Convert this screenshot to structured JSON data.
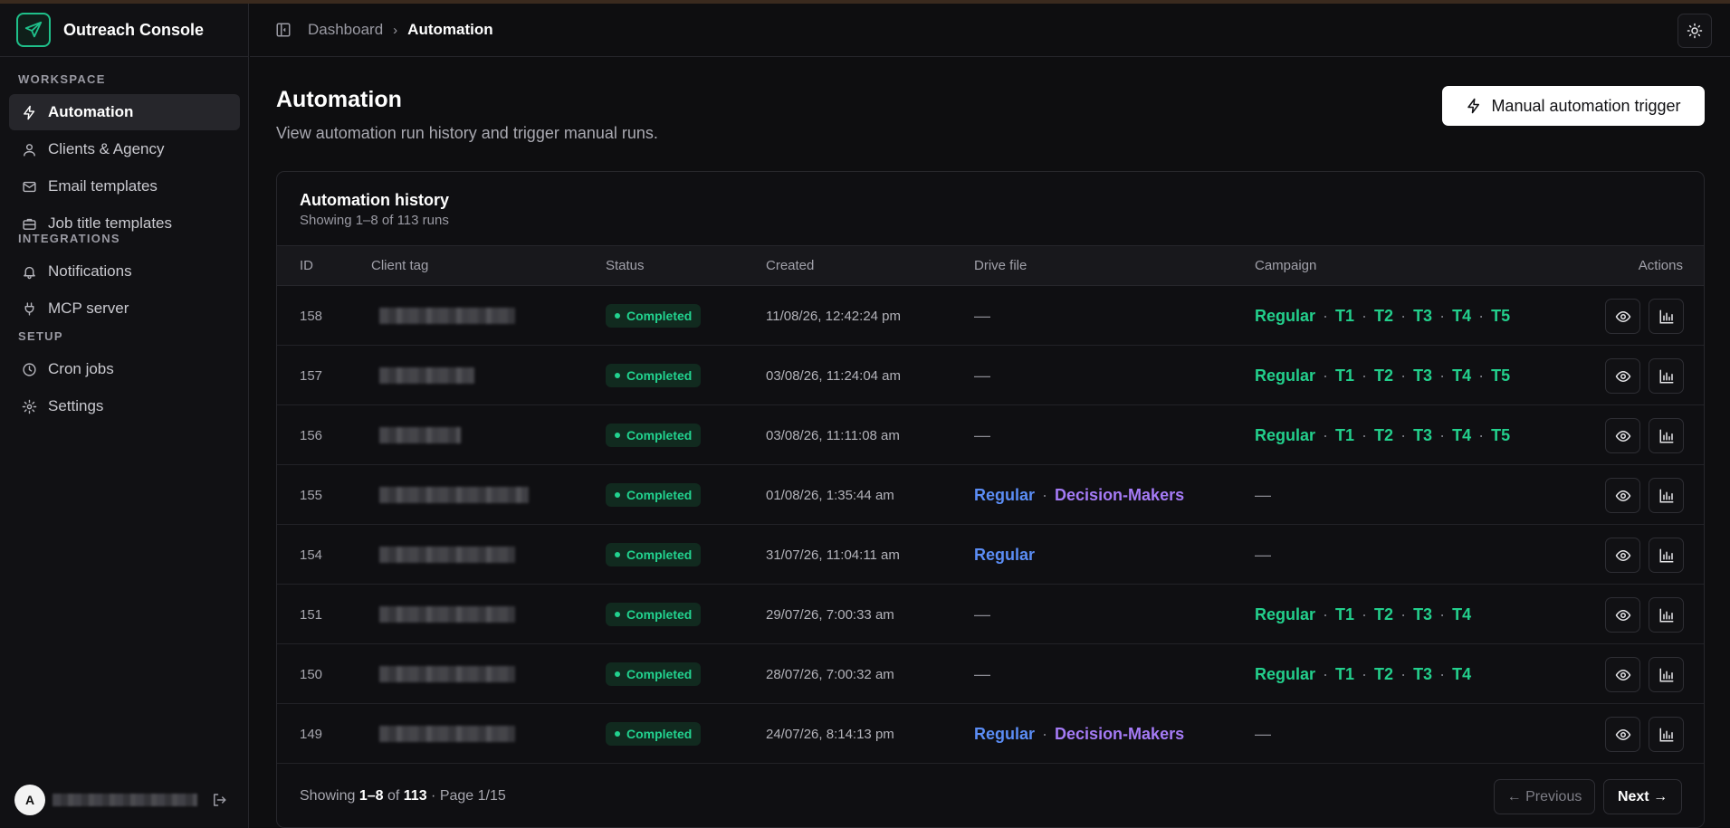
{
  "app": {
    "name": "Outreach Console",
    "user_initial": "A"
  },
  "sidebar": {
    "sections": [
      {
        "label": "Workspace",
        "items": [
          {
            "label": "Automation",
            "icon": "zap-icon",
            "active": true
          },
          {
            "label": "Clients & Agency",
            "icon": "user-icon"
          },
          {
            "label": "Email templates",
            "icon": "mail-icon"
          },
          {
            "label": "Job title templates",
            "icon": "briefcase-icon"
          }
        ]
      },
      {
        "label": "Integrations",
        "items": [
          {
            "label": "Notifications",
            "icon": "bell-icon"
          },
          {
            "label": "MCP server",
            "icon": "plug-icon"
          }
        ]
      },
      {
        "label": "Setup",
        "items": [
          {
            "label": "Cron jobs",
            "icon": "clock-icon"
          },
          {
            "label": "Settings",
            "icon": "gear-icon"
          }
        ]
      }
    ]
  },
  "header": {
    "breadcrumb": [
      "Dashboard",
      "Automation"
    ]
  },
  "page": {
    "title": "Automation",
    "subtitle": "View automation run history and trigger manual runs.",
    "trigger_label": "Manual automation trigger"
  },
  "history": {
    "title": "Automation history",
    "subtitle": "Showing 1–8 of 113 runs",
    "columns": [
      "ID",
      "Client tag",
      "Status",
      "Created",
      "Drive file",
      "Campaign",
      "Actions"
    ],
    "rows": [
      {
        "id": "158",
        "status": "Completed",
        "created": "11/08/26, 12:42:24 pm",
        "drive": [],
        "campaign": [
          "Regular",
          "T1",
          "T2",
          "T3",
          "T4",
          "T5"
        ]
      },
      {
        "id": "157",
        "status": "Completed",
        "created": "03/08/26, 11:24:04 am",
        "drive": [],
        "campaign": [
          "Regular",
          "T1",
          "T2",
          "T3",
          "T4",
          "T5"
        ]
      },
      {
        "id": "156",
        "status": "Completed",
        "created": "03/08/26, 11:11:08 am",
        "drive": [],
        "campaign": [
          "Regular",
          "T1",
          "T2",
          "T3",
          "T4",
          "T5"
        ]
      },
      {
        "id": "155",
        "status": "Completed",
        "created": "01/08/26, 1:35:44 am",
        "drive": [
          "Regular",
          "Decision-Makers"
        ],
        "campaign": []
      },
      {
        "id": "154",
        "status": "Completed",
        "created": "31/07/26, 11:04:11 am",
        "drive": [
          "Regular"
        ],
        "campaign": []
      },
      {
        "id": "151",
        "status": "Completed",
        "created": "29/07/26, 7:00:33 am",
        "drive": [],
        "campaign": [
          "Regular",
          "T1",
          "T2",
          "T3",
          "T4"
        ]
      },
      {
        "id": "150",
        "status": "Completed",
        "created": "28/07/26, 7:00:32 am",
        "drive": [],
        "campaign": [
          "Regular",
          "T1",
          "T2",
          "T3",
          "T4"
        ]
      },
      {
        "id": "149",
        "status": "Completed",
        "created": "24/07/26, 8:14:13 pm",
        "drive": [
          "Regular",
          "Decision-Makers"
        ],
        "campaign": []
      }
    ],
    "empty_value": "—",
    "separator": "·",
    "footer": {
      "showing_prefix": "Showing",
      "range": "1–8",
      "of_label": "of",
      "total": "113",
      "page_label": "· Page 1/15",
      "prev_label": "← Previous",
      "next_label": "Next →"
    }
  },
  "colors": {
    "accent_green": "#23cf8c",
    "drive_blue": "#5b8df5",
    "drive_purple": "#a57bf6",
    "background": "#0e0e10"
  }
}
